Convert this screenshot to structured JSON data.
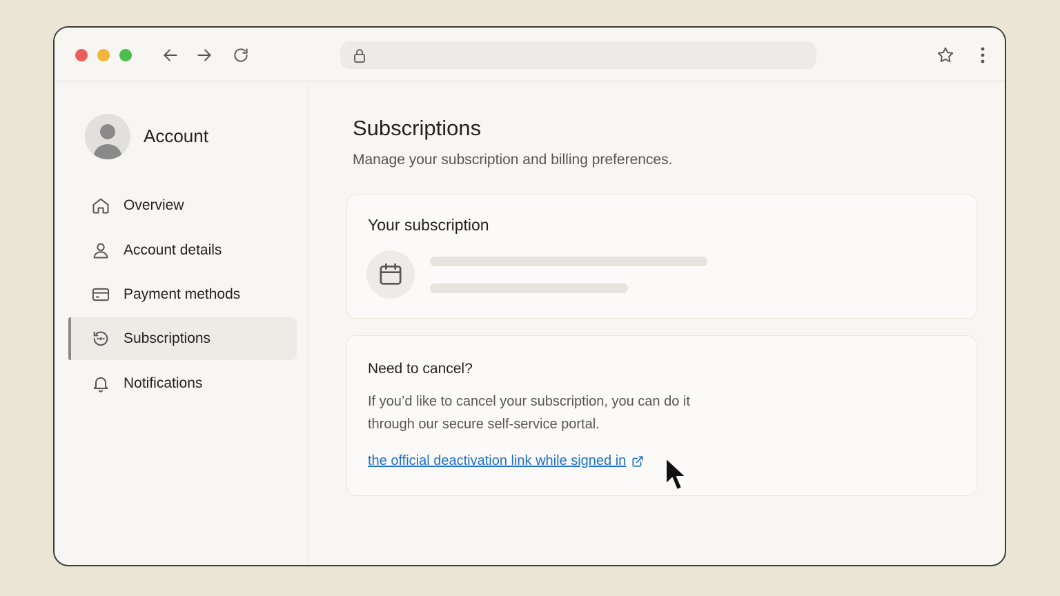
{
  "browser": {
    "icons": [
      "back-arrow-icon",
      "forward-arrow-icon",
      "reload-icon",
      "lock-icon",
      "star-icon",
      "more-vertical-icon"
    ]
  },
  "sidebar": {
    "title": "Account",
    "items": [
      {
        "label": "Overview",
        "icon": "home-icon",
        "active": false
      },
      {
        "label": "Account details",
        "icon": "person-icon",
        "active": false
      },
      {
        "label": "Payment methods",
        "icon": "credit-card-icon",
        "active": false
      },
      {
        "label": "Subscriptions",
        "icon": "subscriptions-icon",
        "active": true
      },
      {
        "label": "Notifications",
        "icon": "bell-icon",
        "active": false
      }
    ]
  },
  "main": {
    "title": "Subscriptions",
    "subtitle": "Manage your subscription and billing preferences.",
    "subscription_card": {
      "title": "Your subscription",
      "icon": "calendar-icon"
    },
    "cancel_card": {
      "title": "Need to cancel?",
      "text": "If you’d like to cancel your subscription, you can do it through our secure self-service portal.",
      "link_label": "the official deactivation link while signed in",
      "link_icon": "external-link-icon"
    }
  },
  "colors": {
    "background": "#ebe5d6",
    "window": "#f8f6f2",
    "link": "#1f6fc8",
    "traffic_red": "#ec5f58",
    "traffic_yellow": "#f2b53b",
    "traffic_green": "#4cbe4f"
  }
}
